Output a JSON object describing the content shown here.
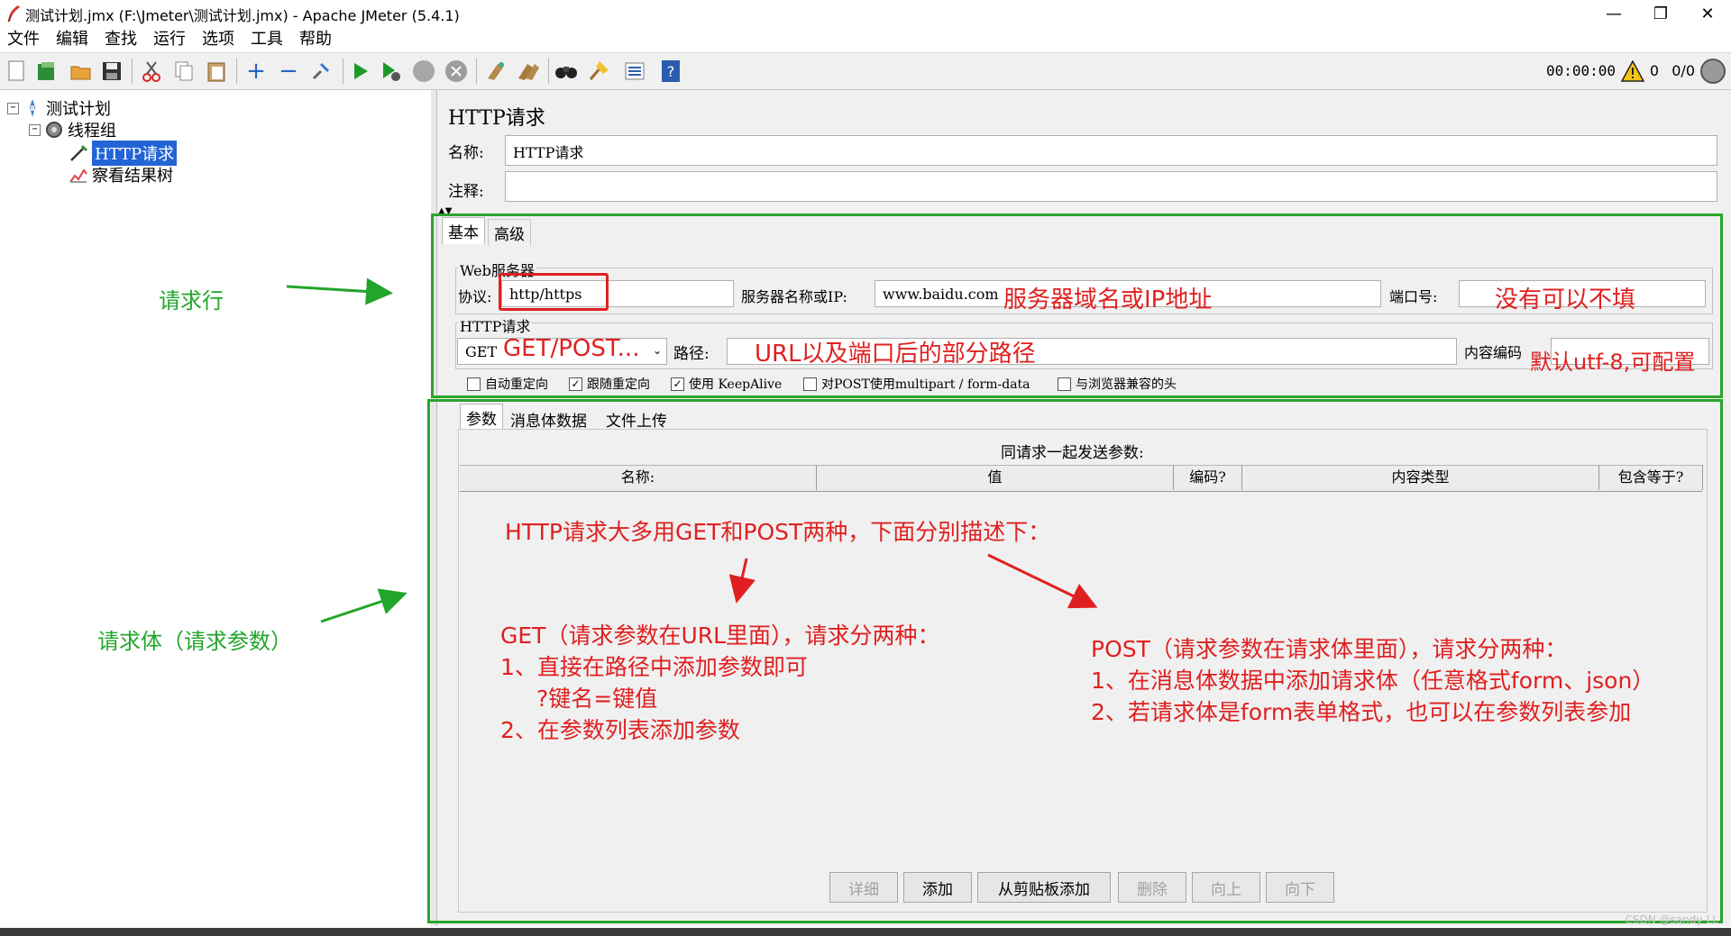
{
  "window": {
    "title": "测试计划.jmx (F:\\Jmeter\\测试计划.jmx) - Apache JMeter (5.4.1)",
    "minimize": "—",
    "maximize": "❐",
    "close": "✕"
  },
  "menu": [
    "文件",
    "编辑",
    "查找",
    "运行",
    "选项",
    "工具",
    "帮助"
  ],
  "toolbar": {
    "icons": [
      "new-icon",
      "templates-icon",
      "open-icon",
      "save-icon",
      "cut-icon",
      "copy-icon",
      "paste-icon",
      "expand-icon",
      "collapse-icon",
      "toggle-icon",
      "start-icon",
      "start-no-pause-icon",
      "stop-icon",
      "shutdown-icon",
      "clear-icon",
      "clear-all-icon",
      "search-icon",
      "reset-search-icon",
      "function-helper-icon",
      "help-icon"
    ],
    "timer": "00:00:00",
    "error_count": "0",
    "thread_count": "0/0"
  },
  "tree": {
    "items": [
      {
        "label": "测试计划",
        "icon": "test-plan-icon"
      },
      {
        "label": "线程组",
        "icon": "thread-group-icon"
      },
      {
        "label": "HTTP请求",
        "icon": "http-sampler-icon"
      },
      {
        "label": "察看结果树",
        "icon": "listener-icon"
      }
    ]
  },
  "panel": {
    "title": "HTTP请求",
    "name_label": "名称:",
    "name_value": "HTTP请求",
    "comment_label": "注释:",
    "comment_value": "",
    "tabs": [
      "基本",
      "高级"
    ],
    "web_server": {
      "group_title": "Web服务器",
      "protocol_label": "协议:",
      "protocol_value": "http/https",
      "server_label": "服务器名称或IP:",
      "server_value": "www.baidu.com",
      "port_label": "端口号:",
      "port_value": ""
    },
    "http_request": {
      "group_title": "HTTP请求",
      "method": "GET",
      "path_label": "路径:",
      "path_value": "",
      "encoding_label": "内容编码",
      "encoding_value": ""
    },
    "checkboxes": [
      {
        "label": "自动重定向",
        "checked": false
      },
      {
        "label": "跟随重定向",
        "checked": true
      },
      {
        "label": "使用 KeepAlive",
        "checked": true
      },
      {
        "label": "对POST使用multipart / form-data",
        "checked": false
      },
      {
        "label": "与浏览器兼容的头",
        "checked": false
      }
    ],
    "sub_tabs": [
      "参数",
      "消息体数据",
      "文件上传"
    ],
    "params_caption": "同请求一起发送参数:",
    "table_headers": [
      "名称:",
      "值",
      "编码?",
      "内容类型",
      "包含等于?"
    ],
    "buttons": [
      {
        "label": "详细",
        "enabled": false
      },
      {
        "label": "添加",
        "enabled": true
      },
      {
        "label": "从剪贴板添加",
        "enabled": true
      },
      {
        "label": "删除",
        "enabled": false
      },
      {
        "label": "向上",
        "enabled": false
      },
      {
        "label": "向下",
        "enabled": false
      }
    ]
  },
  "annotations": {
    "request_line": "请求行",
    "request_body": "请求体（请求参数）",
    "server_note": "服务器域名或IP地址",
    "port_note": "没有可以不填",
    "method_note": "GET/POST...",
    "path_note": "URL以及端口后的部分路径",
    "encoding_note": "默认utf-8,可配置",
    "intro": "HTTP请求大多用GET和POST两种，下面分别描述下：",
    "get_lines": [
      "GET（请求参数在URL里面），请求分两种：",
      "1、直接在路径中添加参数即可",
      "?键名=键值",
      "2、在参数列表添加参数"
    ],
    "post_lines": [
      "POST（请求参数在请求体里面），请求分两种：",
      "1、在消息体数据中添加请求体（任意格式form、json）",
      "2、若请求体是form表单格式，也可以在参数列表参加"
    ],
    "colors": {
      "red": "#e02020",
      "green": "#22a52a"
    }
  },
  "watermark": "CSDN @sandy-LL"
}
